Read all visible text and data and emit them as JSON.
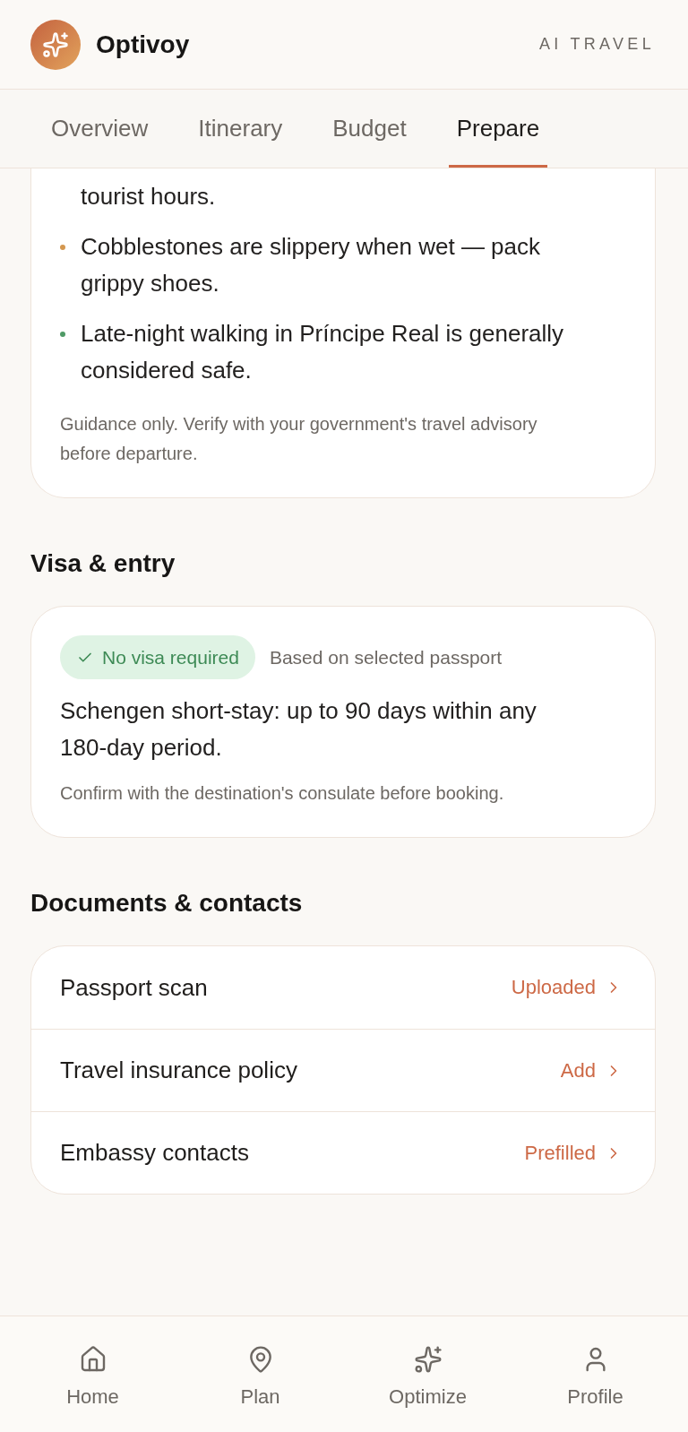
{
  "header": {
    "app_name": "Optivoy",
    "tagline": "AI TRAVEL"
  },
  "tabs": [
    {
      "label": "Overview",
      "selected": false
    },
    {
      "label": "Itinerary",
      "selected": false
    },
    {
      "label": "Budget",
      "selected": false
    },
    {
      "label": "Prepare",
      "selected": true
    }
  ],
  "safety_card": {
    "continued_text": "tourist hours.",
    "items": [
      {
        "color": "#d4974f",
        "text": "Cobblestones are slippery when wet — pack grippy shoes."
      },
      {
        "color": "#4f9a66",
        "text": "Late-night walking in Príncipe Real is generally considered safe."
      }
    ],
    "note": "Guidance only. Verify with your government's travel advisory before departure."
  },
  "visa_section": {
    "title": "Visa & entry",
    "badge": "No visa required",
    "badge_hint": "Based on selected passport",
    "rule": "Schengen short-stay: up to 90 days within any 180-day period.",
    "note": "Confirm with the destination's consulate before booking."
  },
  "documents_section": {
    "title": "Documents & contacts",
    "rows": [
      {
        "label": "Passport scan",
        "status": "Uploaded"
      },
      {
        "label": "Travel insurance policy",
        "status": "Add"
      },
      {
        "label": "Embassy contacts",
        "status": "Prefilled"
      }
    ]
  },
  "bottom_nav": [
    {
      "label": "Home"
    },
    {
      "label": "Plan"
    },
    {
      "label": "Optimize"
    },
    {
      "label": "Profile"
    }
  ]
}
